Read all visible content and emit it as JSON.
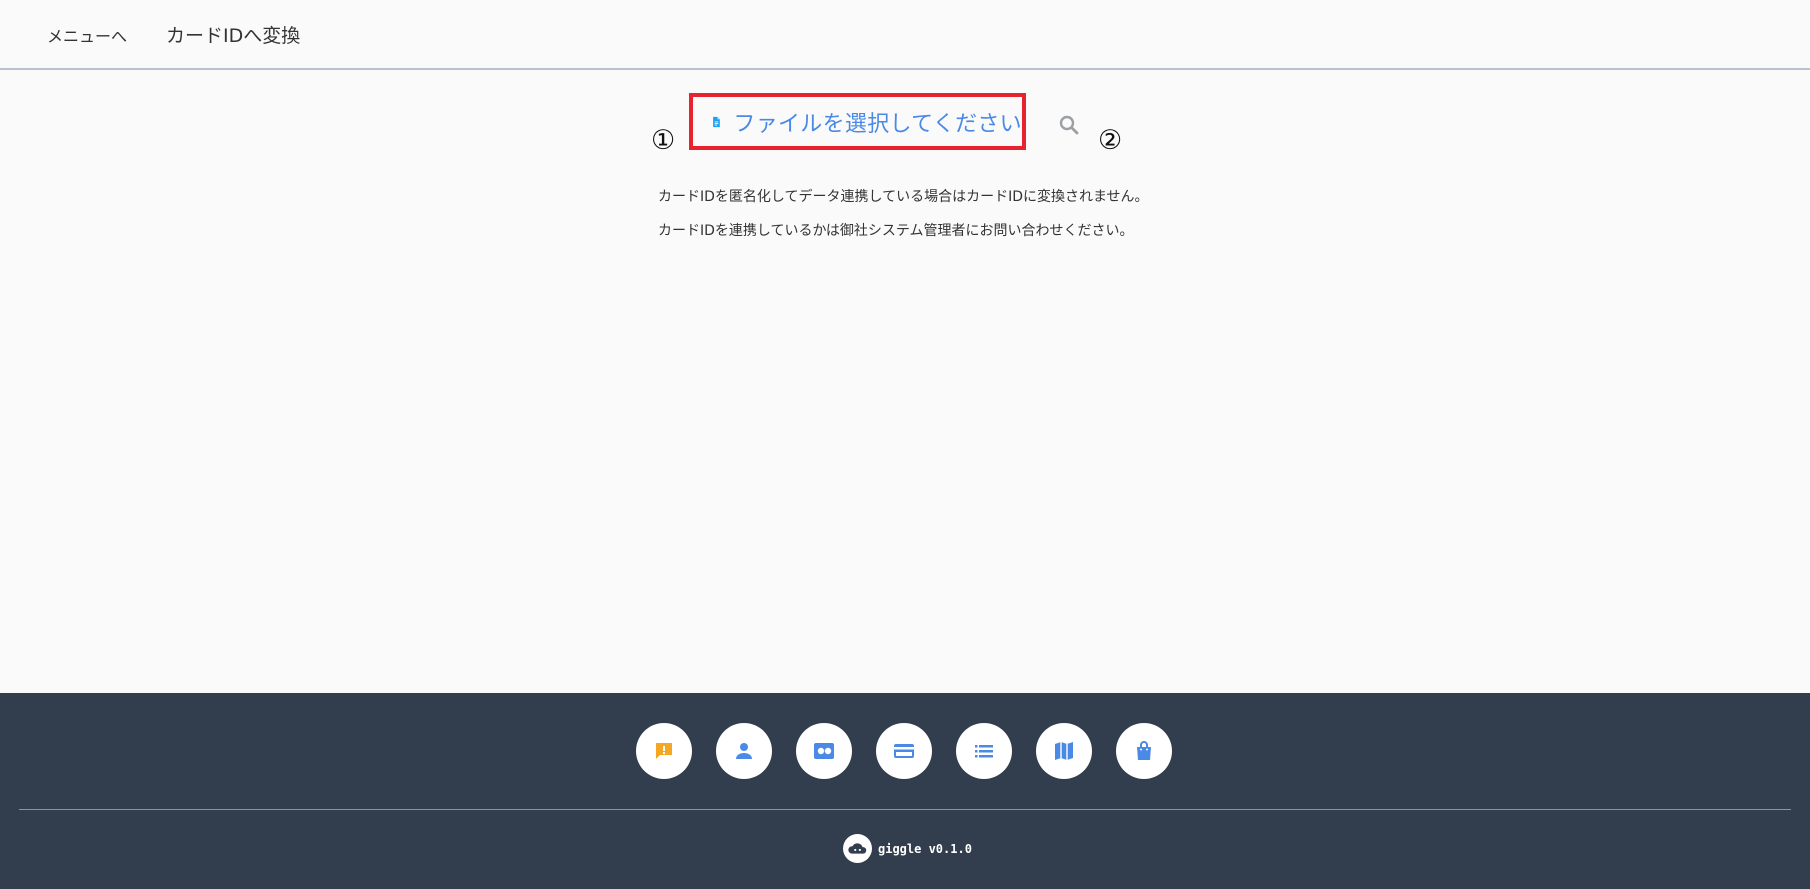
{
  "header": {
    "back_label": "メニューへ",
    "title": "カードIDへ変換"
  },
  "main": {
    "file_select_label": "ファイルを選択してください",
    "step_markers": [
      "①",
      "②"
    ],
    "notes": [
      "カードIDを匿名化してデータ連携している場合はカードIDに変換されません。",
      "カードIDを連携しているかは御社システム管理者にお問い合わせください。"
    ]
  },
  "footer": {
    "icons": [
      {
        "name": "feedback-icon",
        "color": "#f5a623"
      },
      {
        "name": "person-icon",
        "color": "#4a8ae6"
      },
      {
        "name": "id-card-icon",
        "color": "#4a8ae6"
      },
      {
        "name": "credit-card-icon",
        "color": "#4a8ae6"
      },
      {
        "name": "list-icon",
        "color": "#4a8ae6"
      },
      {
        "name": "map-icon",
        "color": "#4a8ae6"
      },
      {
        "name": "shopping-bag-icon",
        "color": "#4a8ae6"
      }
    ],
    "brand_text": "giggle v0.1.0"
  },
  "colors": {
    "accent": "#4a8ae6",
    "highlight_border": "#e8222f",
    "footer_bg": "#323e4d",
    "file_icon": "#1da1f2"
  }
}
